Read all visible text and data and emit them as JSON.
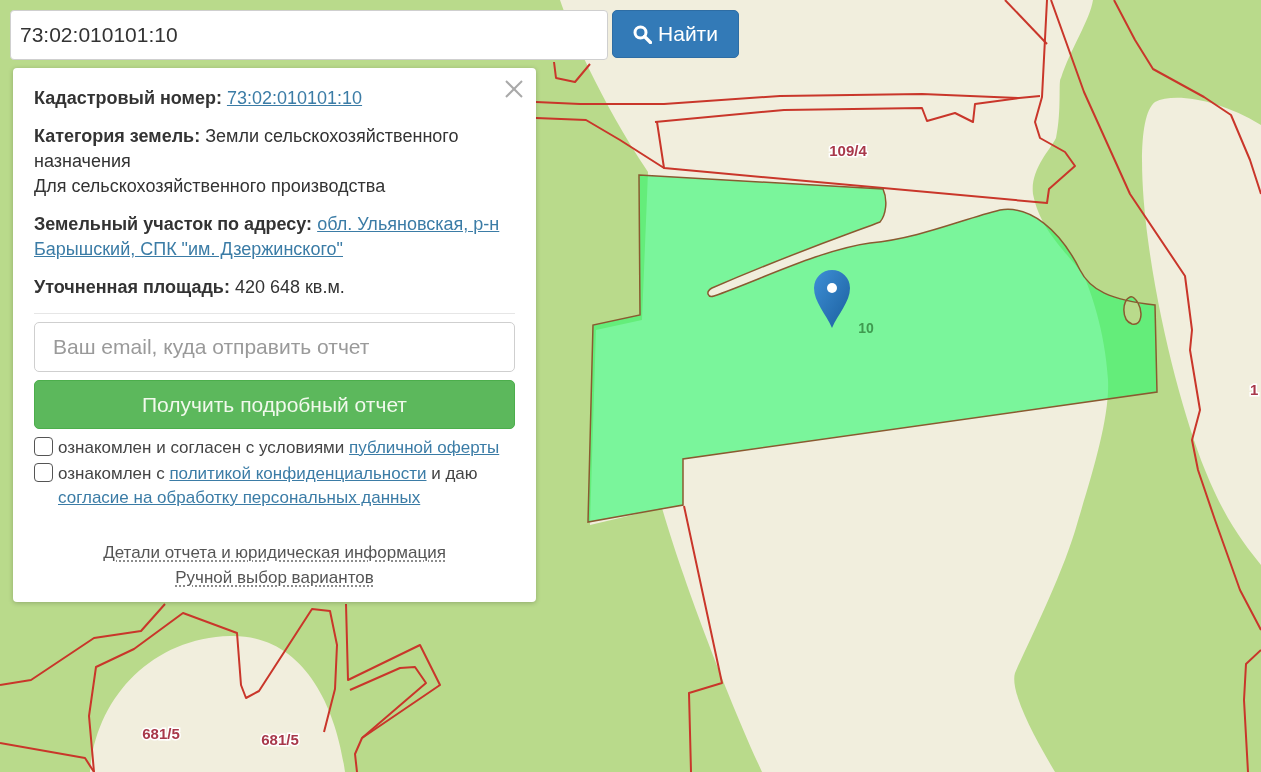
{
  "search": {
    "value": "73:02:010101:10",
    "button": "Найти"
  },
  "info_panel": {
    "fields": [
      {
        "kind": "link",
        "label": "Кадастровый номер:",
        "value_lines": [
          "73:02:010101:10"
        ]
      },
      {
        "kind": "text",
        "label": "Категория земель:",
        "value": "Земли сельскохозяйственного назначения",
        "note": "Для сельскохозяйственного производства"
      },
      {
        "kind": "link",
        "label": "Земельный участок по адресу:",
        "value_lines": [
          "обл. Ульяновская, р-н",
          "Барышский, СПК \"им. Дзержинского\""
        ]
      },
      {
        "kind": "text",
        "label": "Уточненная площадь:",
        "value": "420 648 кв.м."
      }
    ],
    "email": {
      "placeholder": "Ваш email, куда отправить отчет"
    },
    "report_button": "Получить подробный отчет",
    "consents": [
      {
        "checked": false,
        "parts": [
          {
            "kind": "text",
            "text": "ознакомлен и согласен с условиями"
          },
          {
            "kind": "link",
            "text": "публичной оферты"
          }
        ]
      },
      {
        "checked": false,
        "parts": [
          {
            "kind": "text",
            "text": "ознакомлен с"
          },
          {
            "kind": "link",
            "text": "политикой конфиденциальности"
          },
          {
            "kind": "text",
            "text": "и даю"
          },
          {
            "kind": "link",
            "text": "согласие на обработку персональных данных"
          }
        ]
      }
    ],
    "footer_links": [
      "Детали отчета и юридическая информация",
      "Ручной выбор вариантов"
    ]
  },
  "map": {
    "parcel_labels": [
      {
        "label": "109/4"
      },
      {
        "label": "681/5"
      },
      {
        "label": "681/5"
      },
      {
        "label": "1"
      }
    ],
    "selected_parcel": {
      "label": "10"
    }
  }
}
